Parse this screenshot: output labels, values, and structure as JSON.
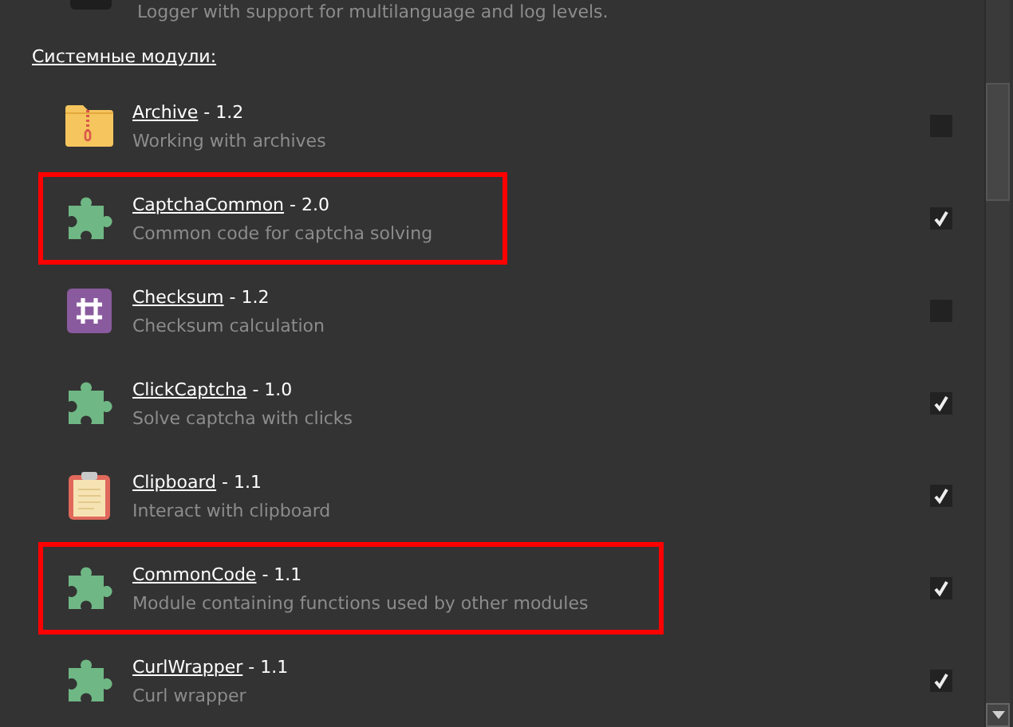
{
  "partial_item": {
    "description": "Logger with support for multilanguage and log levels."
  },
  "section": {
    "title": "Системные модули:"
  },
  "modules": [
    {
      "kind": "archive",
      "name": "Archive",
      "version": " - 1.2",
      "description": "Working with archives",
      "checked": false,
      "highlighted": false
    },
    {
      "kind": "puzzle",
      "name": "CaptchaCommon",
      "version": " - 2.0",
      "description": "Common code for captcha solving",
      "checked": true,
      "highlighted": true
    },
    {
      "kind": "hash",
      "name": "Checksum",
      "version": " - 1.2",
      "description": "Checksum calculation",
      "checked": false,
      "highlighted": false
    },
    {
      "kind": "puzzle",
      "name": "ClickCaptcha",
      "version": " - 1.0",
      "description": "Solve captcha with clicks",
      "checked": true,
      "highlighted": false
    },
    {
      "kind": "clipboard",
      "name": "Clipboard",
      "version": " - 1.1",
      "description": "Interact with clipboard",
      "checked": true,
      "highlighted": false
    },
    {
      "kind": "puzzle",
      "name": "CommonCode",
      "version": " - 1.1",
      "description": "Module containing functions used by other modules",
      "checked": true,
      "highlighted": true
    },
    {
      "kind": "puzzle",
      "name": "CurlWrapper",
      "version": " - 1.1",
      "description": "Curl wrapper",
      "checked": true,
      "highlighted": false
    }
  ]
}
